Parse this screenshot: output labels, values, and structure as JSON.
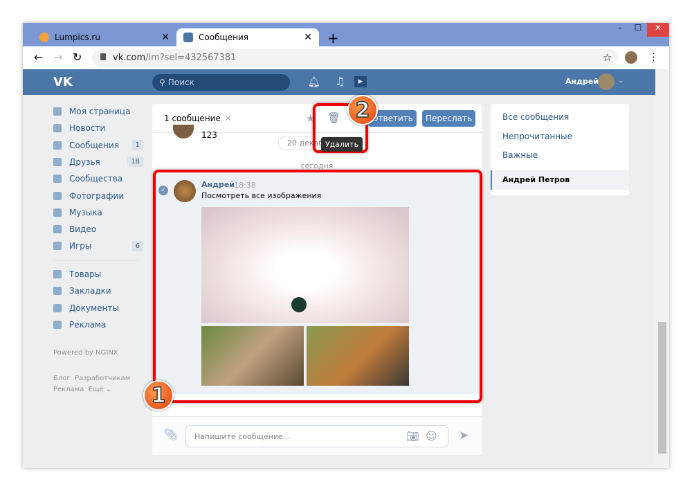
{
  "browser": {
    "tabs": [
      {
        "label": "Lumpics.ru"
      },
      {
        "label": "Сообщения"
      }
    ],
    "url_host": "vk.com",
    "url_path": "/im?sel=432567381"
  },
  "header": {
    "search_placeholder": "Поиск",
    "user_name": "Андрей"
  },
  "sidebar": {
    "items": [
      {
        "label": "Моя страница"
      },
      {
        "label": "Новости"
      },
      {
        "label": "Сообщения",
        "count": "1"
      },
      {
        "label": "Друзья",
        "count": "18"
      },
      {
        "label": "Сообщества"
      },
      {
        "label": "Фотографии"
      },
      {
        "label": "Музыка"
      },
      {
        "label": "Видео"
      },
      {
        "label": "Игры",
        "count": "6"
      }
    ],
    "items2": [
      {
        "label": "Товары"
      },
      {
        "label": "Закладки"
      },
      {
        "label": "Документы"
      },
      {
        "label": "Реклама"
      }
    ],
    "powered": "Powered by NGINX",
    "footer": [
      "Блог",
      "Разработчикам",
      "Реклама",
      "Ещё ⌄"
    ]
  },
  "chat": {
    "selected": "1 сообщение",
    "reply": "Ответить",
    "forward": "Переслать",
    "tooltip": "Удалить",
    "prev_text": "123",
    "date_pill": "20 декабря 2018",
    "today": "сегодня",
    "message": {
      "author": "Андрей",
      "time": "18:38",
      "text": "Посмотреть все изображения"
    },
    "input_placeholder": "Напишите сообщение..."
  },
  "right": {
    "items": [
      "Все сообщения",
      "Непрочитанные",
      "Важные",
      "Андрей Петров"
    ]
  },
  "annotations": [
    "1",
    "2"
  ]
}
